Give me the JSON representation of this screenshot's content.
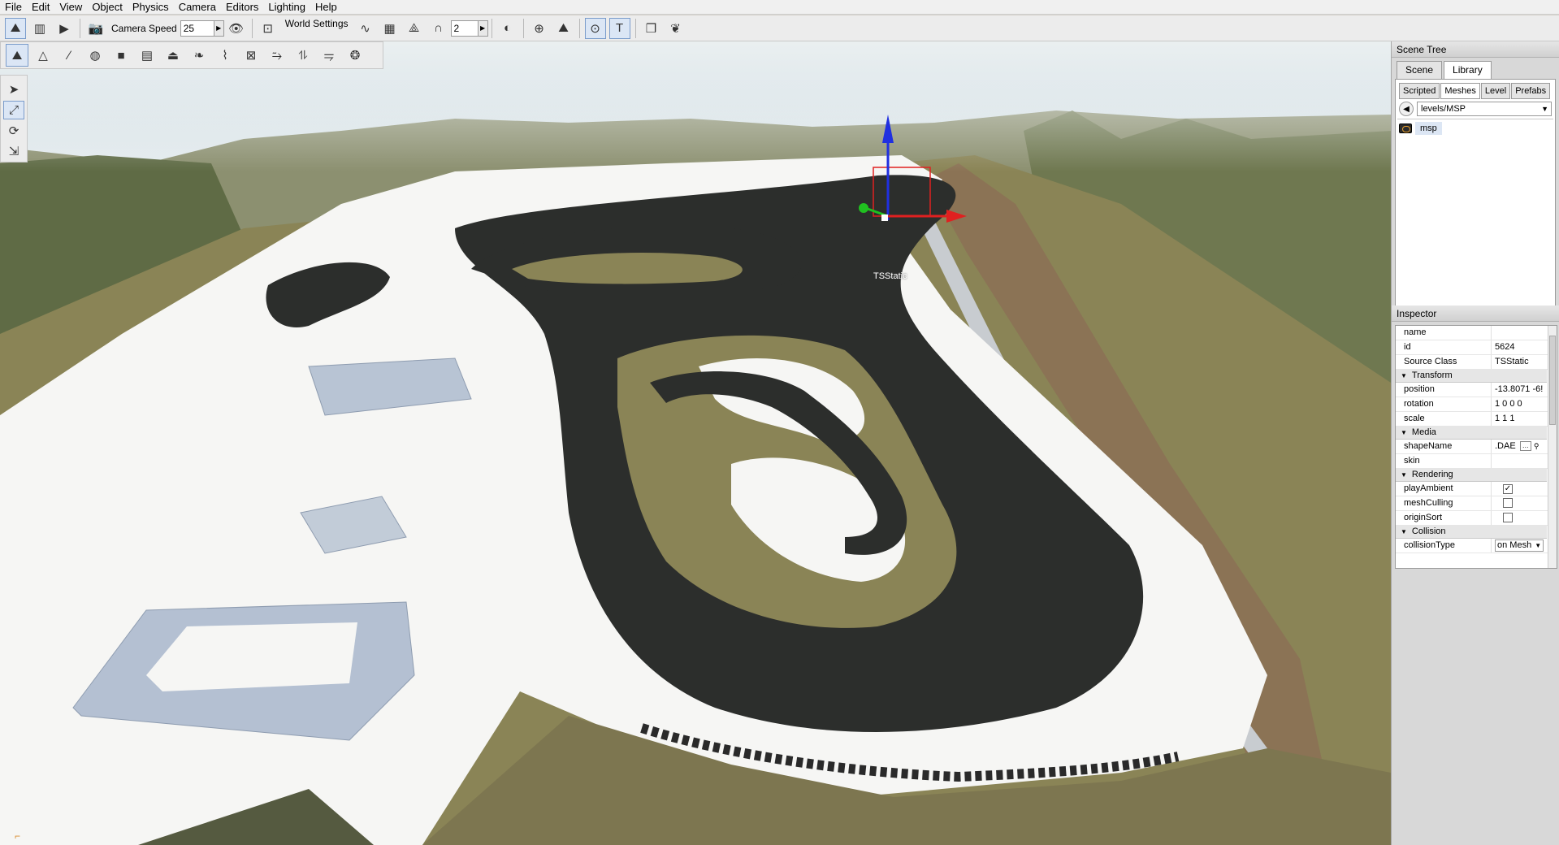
{
  "menu": [
    "File",
    "Edit",
    "View",
    "Object",
    "Physics",
    "Camera",
    "Editors",
    "Lighting",
    "Help"
  ],
  "toolbar": {
    "camera_speed_label": "Camera Speed",
    "camera_speed_value": "25",
    "world_settings_label": "World Settings",
    "snap_value": "2"
  },
  "viewport": {
    "selected_object_label": "TSStatic"
  },
  "scene_tree": {
    "title": "Scene Tree",
    "tabs": [
      "Scene",
      "Library"
    ],
    "selected_tab": "Library",
    "subtabs": [
      "Scripted",
      "Meshes",
      "Level",
      "Prefabs"
    ],
    "selected_subtab": "Meshes",
    "path": "levels/MSP",
    "items": [
      {
        "label": "msp"
      }
    ]
  },
  "inspector": {
    "title": "Inspector",
    "rows": {
      "name": {
        "key": "name",
        "value": ""
      },
      "id": {
        "key": "id",
        "value": "5624"
      },
      "source_class": {
        "key": "Source Class",
        "value": "TSStatic"
      }
    },
    "groups": {
      "transform": "Transform",
      "media": "Media",
      "rendering": "Rendering",
      "collision": "Collision"
    },
    "transform": {
      "position": {
        "key": "position",
        "value": "-13.8071 -6!"
      },
      "rotation": {
        "key": "rotation",
        "value": "1 0 0 0"
      },
      "scale": {
        "key": "scale",
        "value": "1 1 1"
      }
    },
    "media": {
      "shape_name": {
        "key": "shapeName",
        "value": ".DAE"
      },
      "skin": {
        "key": "skin",
        "value": ""
      }
    },
    "rendering": {
      "play_ambient": {
        "key": "playAmbient",
        "checked": true
      },
      "mesh_culling": {
        "key": "meshCulling",
        "checked": false
      },
      "origin_sort": {
        "key": "originSort",
        "checked": false
      }
    },
    "collision": {
      "collision_type": {
        "key": "collisionType",
        "value": "on Mesh"
      }
    }
  },
  "colors": {
    "snow": "#f6f6f4",
    "asphalt": "#2c2e2c",
    "grass": "#8a8456",
    "dirt": "#8b7355",
    "sky": "#dfe9ee",
    "forest": "#5f6b45",
    "gizmo_x": "#e02020",
    "gizmo_y": "#20c020",
    "gizmo_z": "#2030e0"
  }
}
